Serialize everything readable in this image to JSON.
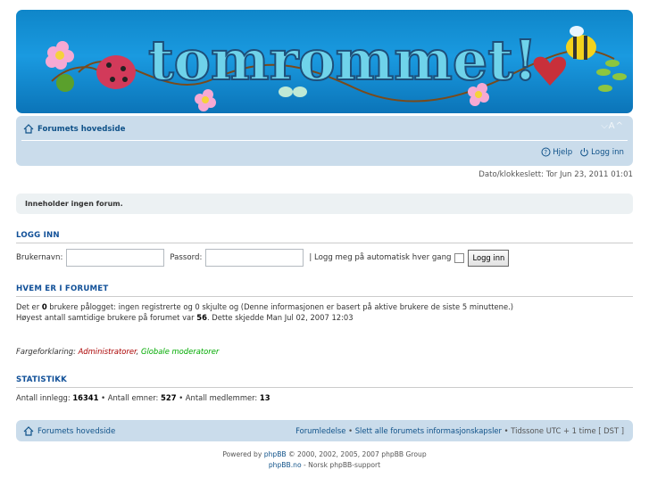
{
  "banner": {
    "logo_text": "tomrommet!"
  },
  "navbar": {
    "home_label": "Forumets hovedside",
    "fontsize_label": "⌵A^",
    "help_label": "Hjelp",
    "login_label": "Logg inn"
  },
  "datetime": "Dato/klokkeslett: Tor Jun 23, 2011 01:01",
  "noforum": "Inneholder ingen forum.",
  "login": {
    "heading": "LOGG INN",
    "username_label": "Brukernavn:",
    "password_label": "Passord:",
    "autologin_label": "| Logg meg på automatisk hver gang",
    "submit_label": "Logg inn",
    "username_value": "",
    "password_value": ""
  },
  "online": {
    "heading": "HVEM ER I FORUMET",
    "line1_pre": "Det er ",
    "line1_count": "0",
    "line1_post": " brukere pålogget: ingen registrerte og 0 skjulte og (Denne informasjonen er basert på aktive brukere de siste 5 minuttene.)",
    "line2_pre": "Høyest antall samtidige brukere på forumet var ",
    "line2_count": "56",
    "line2_post": ". Dette skjedde Man Jul 02, 2007 12:03",
    "legend_label": "Fargeforklaring: ",
    "legend_admin": "Administratorer",
    "legend_sep": ", ",
    "legend_gmod": "Globale moderatorer"
  },
  "stats": {
    "heading": "STATISTIKK",
    "posts_label": "Antall innlegg: ",
    "posts": "16341",
    "topics_label": " • Antall emner: ",
    "topics": "527",
    "members_label": " • Antall medlemmer: ",
    "members": "13"
  },
  "footer": {
    "home_label": "Forumets hovedside",
    "team_label": "Forumledelse",
    "sep1": " • ",
    "cookies_label": "Slett alle forumets informasjonskapsler",
    "timezone": " • Tidssone UTC + 1 time [ DST ]"
  },
  "copyright": {
    "powered_pre": "Powered by ",
    "phpbb": "phpBB",
    "powered_post": " © 2000, 2002, 2005, 2007 phpBB Group",
    "support_link": "phpBB.no",
    "support_post": " - Norsk phpBB-support"
  },
  "colors": {
    "link": "#105289",
    "heading": "#115098",
    "navbar_bg": "#cadceb",
    "admin": "#aa0000",
    "gmod": "#00aa00"
  }
}
